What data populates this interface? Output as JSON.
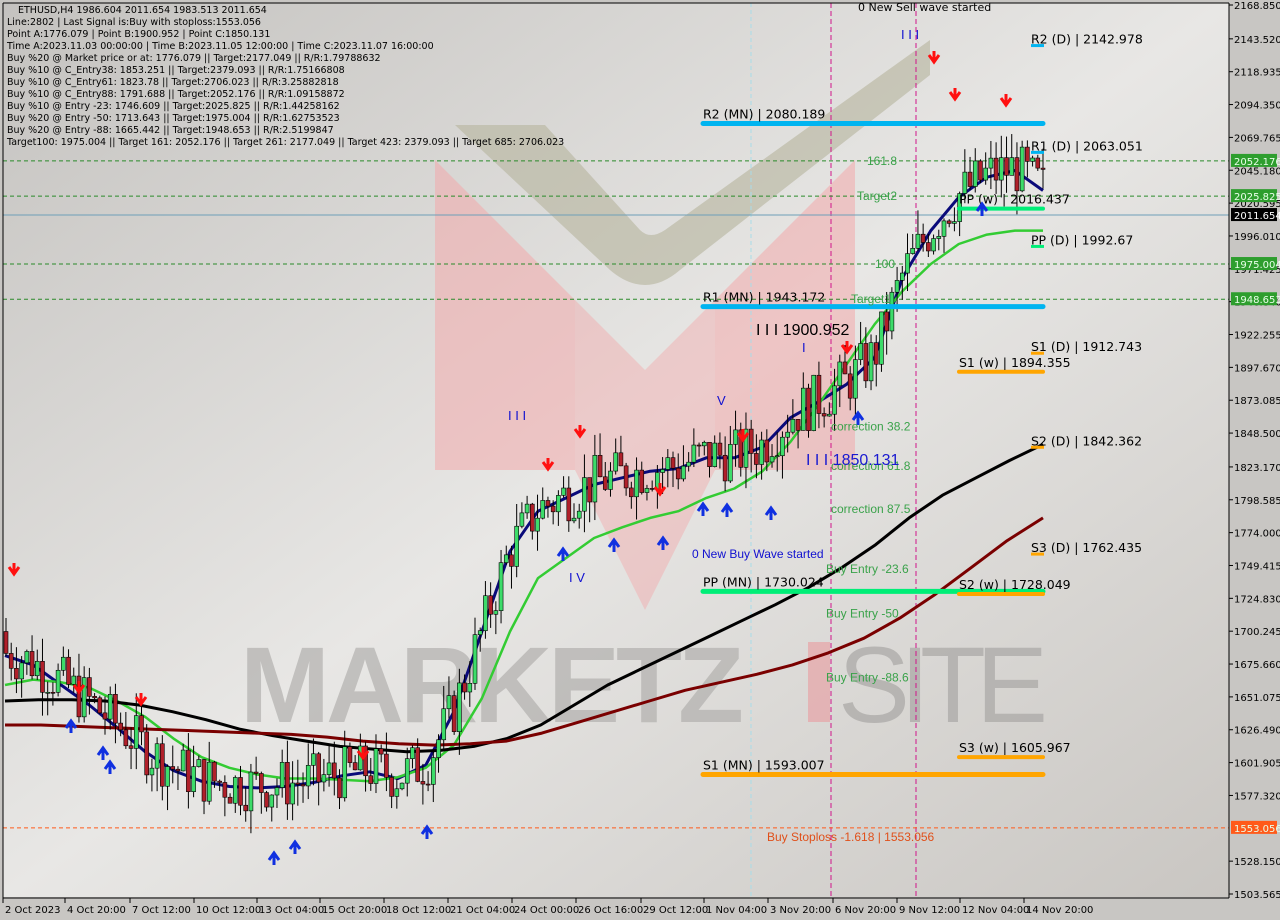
{
  "info_panel": {
    "lines": [
      "ETHUSD,H4  1986.604 2011.654 1983.513 2011.654",
      "Line:2802 | Last Signal is:Buy with stoploss:1553.056",
      "Point A:1776.079 | Point B:1900.952 | Point C:1850.131",
      "Time A:2023.11.03 00:00:00 | Time B:2023.11.05 12:00:00 | Time C:2023.11.07 16:00:00",
      "Buy %20 @ Market price or at: 1776.079 || Target:2177.049 || R/R:1.79788632",
      "Buy %10 @ C_Entry38: 1853.251 || Target:2379.093 || R/R:1.75166808",
      "Buy %10 @ C_Entry61: 1823.78 || Target:2706.023 || R/R:3.25882818",
      "Buy %10 @ C_Entry88: 1791.688 || Target:2052.176 || R/R:1.09158872",
      "Buy %10 @ Entry -23: 1746.609 || Target:2025.825 || R/R:1.44258162",
      "Buy %20 @ Entry -50: 1713.643 || Target:1975.004 || R/R:1.62753523",
      "Buy %20 @ Entry -88: 1665.442 || Target:1948.653 || R/R:2.5199847",
      "Target100: 1975.004 || Target 161: 2052.176 || Target 261: 2177.049 || Target 423: 2379.093 || Target 685: 2706.023"
    ]
  },
  "colors": {
    "background": "#c8c6c3",
    "bull_candle": "#3ddc6a",
    "bear_candle": "#b0202a",
    "ma_fast": "#0a0a7a",
    "ma_mid": "#33cc33",
    "ma_slow": "#000000",
    "ma_slowest": "#7a0000",
    "pivot_mn_resistance": "#00b4f0",
    "pivot_pp": "#00ee77",
    "pivot_support": "#ffa500",
    "target_line": "#2a8a2a",
    "stoploss": "#ff5a1a",
    "current_price": "#000000",
    "signal_down": "#ff1010",
    "signal_up": "#1030e0",
    "watermark": "#b8b6b4"
  },
  "chart_data": {
    "type": "candlestick",
    "symbol": "ETHUSD",
    "timeframe": "H4",
    "ohlc_current": {
      "open": 1986.604,
      "high": 2011.654,
      "low": 1983.513,
      "close": 2011.654
    },
    "ylim": [
      1503.565,
      2168.85
    ],
    "y_ticks": [
      "2168.850",
      "2143.520",
      "2118.935",
      "2094.350",
      "2069.765",
      "2045.180",
      "2020.595",
      "1996.010",
      "1971.425",
      "1946.840",
      "1922.255",
      "1897.670",
      "1873.085",
      "1848.500",
      "1823.170",
      "1798.585",
      "1774.000",
      "1749.415",
      "1724.830",
      "1700.245",
      "1675.660",
      "1651.075",
      "1626.490",
      "1601.905",
      "1577.320",
      "1528.150",
      "1503.565"
    ],
    "x_ticks": [
      "2 Oct 2023",
      "4 Oct 20:00",
      "7 Oct 12:00",
      "10 Oct 12:00",
      "13 Oct 04:00",
      "15 Oct 20:00",
      "18 Oct 12:00",
      "21 Oct 04:00",
      "24 Oct 00:00",
      "26 Oct 16:00",
      "29 Oct 12:00",
      "1 Nov 04:00",
      "3 Nov 20:00",
      "6 Nov 20:00",
      "9 Nov 12:00",
      "12 Nov 04:00",
      "14 Nov 20:00"
    ],
    "price_tags": [
      {
        "value": 2052.176,
        "label": "2052.176",
        "kind": "target"
      },
      {
        "value": 2025.825,
        "label": "2025.825",
        "kind": "target"
      },
      {
        "value": 2011.654,
        "label": "2011.654",
        "kind": "current"
      },
      {
        "value": 1975.004,
        "label": "1975.004",
        "kind": "target"
      },
      {
        "value": 1948.653,
        "label": "1948.653",
        "kind": "target"
      },
      {
        "value": 1553.056,
        "label": "1553.056",
        "kind": "stoploss"
      }
    ],
    "target_lines": [
      2052.176,
      2025.825,
      1975.004,
      1948.653
    ],
    "current_price": 2011.654,
    "stoploss": {
      "value": 1553.056,
      "label": "Buy Stoploss -1.618 | 1553.056"
    },
    "pivots": [
      {
        "label": "R2 (MN) | 2080.189",
        "value": 2080.189,
        "kind": "mn_res",
        "x_from": 0.55,
        "x_to": 0.817
      },
      {
        "label": "R1 (MN) | 1943.172",
        "value": 1943.172,
        "kind": "mn_res",
        "x_from": 0.55,
        "x_to": 0.817
      },
      {
        "label": "PP (MN) | 1730.024",
        "value": 1730.024,
        "kind": "pp",
        "x_from": 0.55,
        "x_to": 0.817
      },
      {
        "label": "S1 (MN) | 1593.007",
        "value": 1593.007,
        "kind": "sup",
        "x_from": 0.55,
        "x_to": 0.817
      },
      {
        "label": "PP (w) | 2016.437",
        "value": 2016.437,
        "kind": "pp",
        "x_from": 0.749,
        "x_to": 0.817
      },
      {
        "label": "S1 (w) | 1894.355",
        "value": 1894.355,
        "kind": "sup",
        "x_from": 0.749,
        "x_to": 0.817
      },
      {
        "label": "S2 (w) | 1728.049",
        "value": 1728.049,
        "kind": "sup",
        "x_from": 0.749,
        "x_to": 0.817
      },
      {
        "label": "S3 (w) | 1605.967",
        "value": 1605.967,
        "kind": "sup",
        "x_from": 0.749,
        "x_to": 0.817
      },
      {
        "label": "R2 (D) | 2142.978",
        "value": 2142.978,
        "kind": "daily_res"
      },
      {
        "label": "R1 (D) | 2063.051",
        "value": 2063.051,
        "kind": "daily_res"
      },
      {
        "label": "PP (D) | 1992.67",
        "value": 1992.67,
        "kind": "daily_pp"
      },
      {
        "label": "S1 (D) | 1912.743",
        "value": 1912.743,
        "kind": "daily_sup"
      },
      {
        "label": "S2 (D) | 1842.362",
        "value": 1842.362,
        "kind": "daily_sup"
      },
      {
        "label": "S3 (D) | 1762.435",
        "value": 1762.435,
        "kind": "daily_sup"
      }
    ],
    "fib_labels": [
      {
        "text": "161.8",
        "value": 2052.176
      },
      {
        "text": "Target2",
        "value": 2025.825
      },
      {
        "text": "100",
        "value": 1975.004
      },
      {
        "text": "Target1",
        "value": 1948.653
      },
      {
        "text": "correction 38.2",
        "value": 1853.251
      },
      {
        "text": "correction 61.8",
        "value": 1823.78
      },
      {
        "text": "correction 87.5",
        "value": 1791.688
      },
      {
        "text": "Buy Entry -23.6",
        "value": 1746.609
      },
      {
        "text": "Buy Entry -50",
        "value": 1713.643
      },
      {
        "text": "Buy Entry -88.6",
        "value": 1665.442
      }
    ],
    "wave_annotations": [
      {
        "text": "0 New Sell wave started",
        "value": 2165
      },
      {
        "text": "0 New Buy Wave started",
        "value": 1764
      },
      {
        "text": "I I I 1900.952",
        "value": 1907
      },
      {
        "text": "I I I 1850.131",
        "value": 1843
      }
    ],
    "moving_averages": [
      {
        "name": "ma_fast",
        "values": [
          1682,
          1675,
          1660,
          1645,
          1628,
          1610,
          1596,
          1588,
          1584,
          1583,
          1584,
          1587,
          1592,
          1595,
          1590,
          1600,
          1640,
          1700,
          1760,
          1790,
          1800,
          1810,
          1815,
          1820,
          1822,
          1830,
          1830,
          1838,
          1860,
          1872,
          1885,
          1905,
          1965,
          2000,
          2025,
          2040,
          2045,
          2030
        ]
      },
      {
        "name": "ma_mid",
        "values": [
          1660,
          1664,
          1662,
          1658,
          1648,
          1636,
          1620,
          1606,
          1598,
          1593,
          1590,
          1590,
          1589,
          1588,
          1591,
          1598,
          1615,
          1650,
          1700,
          1740,
          1755,
          1770,
          1778,
          1785,
          1790,
          1800,
          1807,
          1820,
          1842,
          1870,
          1900,
          1930,
          1955,
          1975,
          1990,
          1997,
          2000,
          2000
        ]
      },
      {
        "name": "ma_slow",
        "values": [
          1648,
          1649,
          1649,
          1648,
          1645,
          1640,
          1634,
          1627,
          1622,
          1618,
          1614,
          1612,
          1610,
          1611,
          1614,
          1620,
          1630,
          1645,
          1660,
          1672,
          1684,
          1696,
          1708,
          1720,
          1733,
          1748,
          1765,
          1785,
          1802,
          1815,
          1828,
          1840
        ]
      },
      {
        "name": "ma_slowest",
        "values": [
          1630,
          1630,
          1629,
          1628,
          1627,
          1626,
          1625,
          1624,
          1623,
          1621,
          1618,
          1616,
          1615,
          1616,
          1618,
          1624,
          1632,
          1640,
          1648,
          1656,
          1662,
          1668,
          1675,
          1684,
          1695,
          1710,
          1728,
          1748,
          1768,
          1785
        ]
      }
    ]
  },
  "watermark": {
    "text_left": "MARKETZ",
    "text_right": "SITE"
  }
}
